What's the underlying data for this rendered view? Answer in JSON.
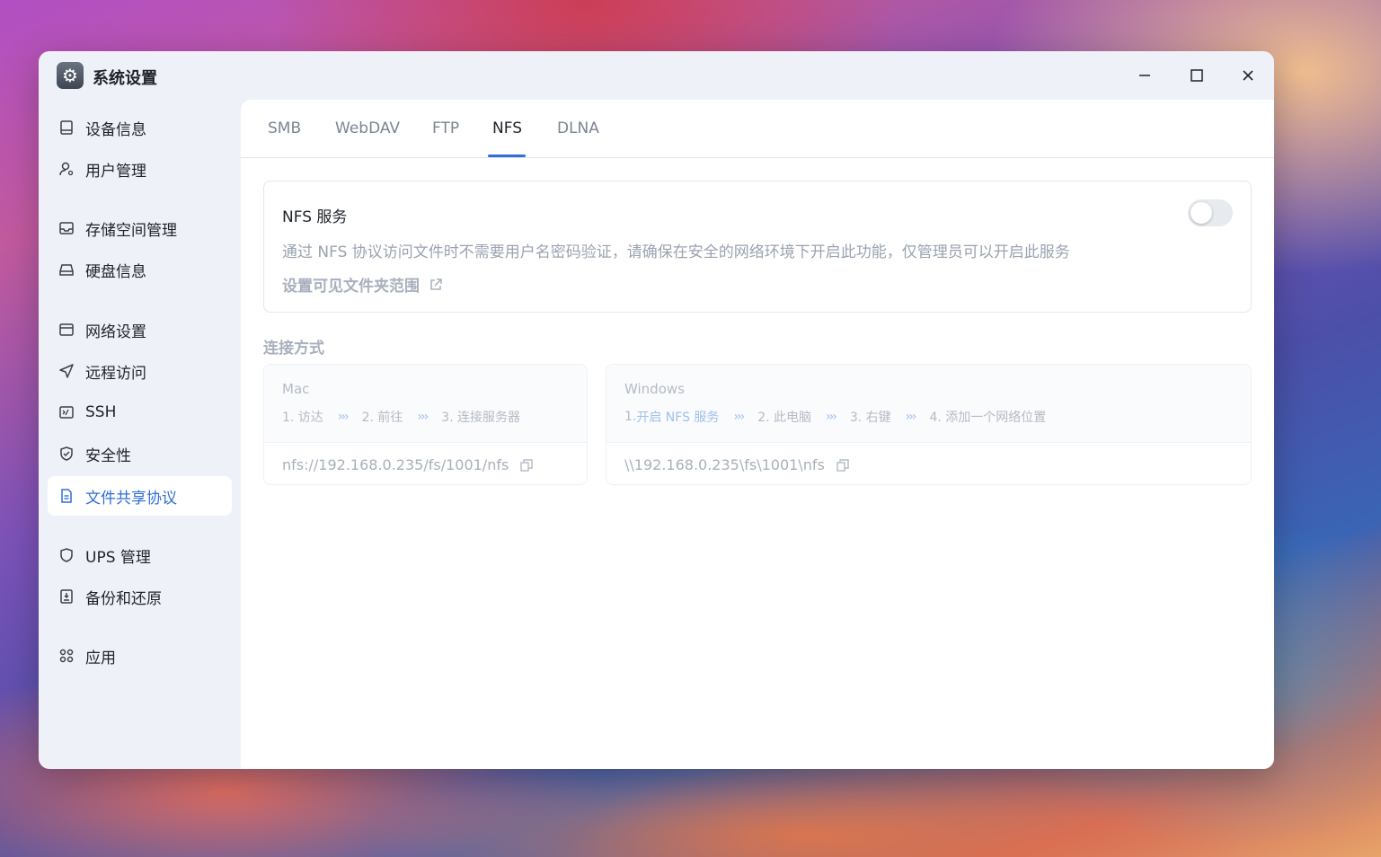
{
  "window": {
    "title": "系统设置",
    "app_icon": "gear-icon"
  },
  "window_controls": {
    "minimize": "minimize-icon",
    "maximize": "maximize-icon",
    "close": "close-icon"
  },
  "sidebar": {
    "items": [
      {
        "label": "设备信息",
        "icon": "device-icon"
      },
      {
        "label": "用户管理",
        "icon": "user-icon"
      },
      {
        "label": "存储空间管理",
        "icon": "storage-icon"
      },
      {
        "label": "硬盘信息",
        "icon": "disk-icon"
      },
      {
        "label": "网络设置",
        "icon": "network-icon"
      },
      {
        "label": "远程访问",
        "icon": "send-icon"
      },
      {
        "label": "SSH",
        "icon": "terminal-icon"
      },
      {
        "label": "安全性",
        "icon": "shield-check-icon"
      },
      {
        "label": "文件共享协议",
        "icon": "document-icon",
        "active": true
      },
      {
        "label": "UPS 管理",
        "icon": "shield-icon"
      },
      {
        "label": "备份和还原",
        "icon": "backup-icon"
      },
      {
        "label": "应用",
        "icon": "apps-icon"
      }
    ]
  },
  "tabs": [
    {
      "label": "SMB"
    },
    {
      "label": "WebDAV"
    },
    {
      "label": "FTP"
    },
    {
      "label": "NFS",
      "active": true
    },
    {
      "label": "DLNA"
    }
  ],
  "nfs_service": {
    "title": "NFS 服务",
    "description": "通过 NFS 协议访问文件时不需要用户名密码验证，请确保在安全的网络环境下开启此功能，仅管理员可以开启此服务",
    "link_label": "设置可见文件夹范围",
    "enabled": false
  },
  "connection": {
    "section_title": "连接方式",
    "mac": {
      "os": "Mac",
      "steps": [
        "1. 访达",
        "2. 前往",
        "3. 连接服务器"
      ],
      "path": "nfs://192.168.0.235/fs/1001/nfs"
    },
    "windows": {
      "os": "Windows",
      "step1_prefix": "1. ",
      "step1_link": "开启 NFS 服务",
      "steps": [
        "2. 此电脑",
        "3. 右键",
        "4. 添加一个网络位置"
      ],
      "path": "\\\\192.168.0.235\\fs\\1001\\nfs"
    },
    "arrow": "›››"
  },
  "colors": {
    "accent": "#2f6fd6",
    "muted_text": "#9aa3b0",
    "sidebar_bg": "#eef2f8"
  }
}
